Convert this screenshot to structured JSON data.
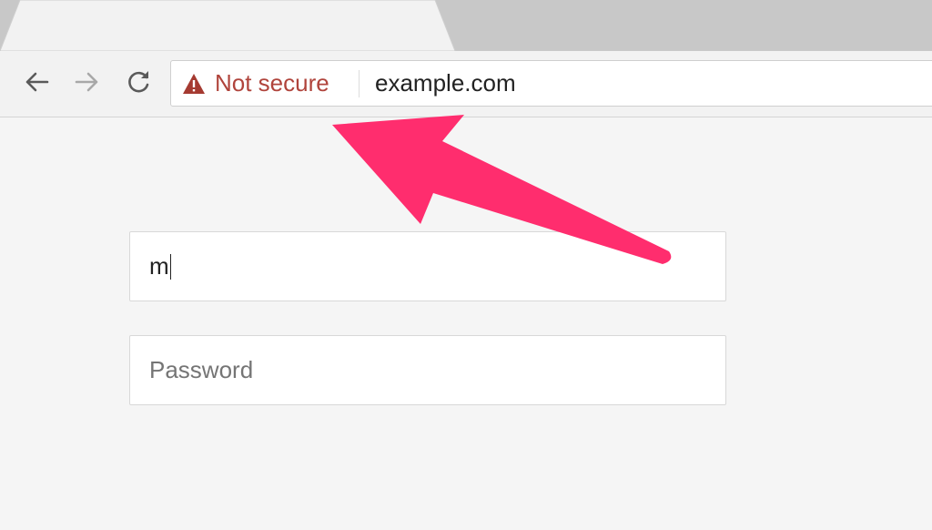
{
  "browser": {
    "toolbar": {
      "back_icon": "arrow-left-icon",
      "forward_icon": "arrow-right-icon",
      "reload_icon": "reload-icon"
    },
    "omnibox": {
      "security_icon": "warning-triangle-icon",
      "security_label": "Not secure",
      "url": "example.com"
    }
  },
  "form": {
    "username": {
      "value": "m"
    },
    "password": {
      "placeholder": "Password"
    }
  },
  "annotation": {
    "icon": "pointer-arrow-icon",
    "color": "#ff2d6e"
  },
  "colors": {
    "warning": "#b0443c",
    "accent": "#ff2d6e"
  }
}
